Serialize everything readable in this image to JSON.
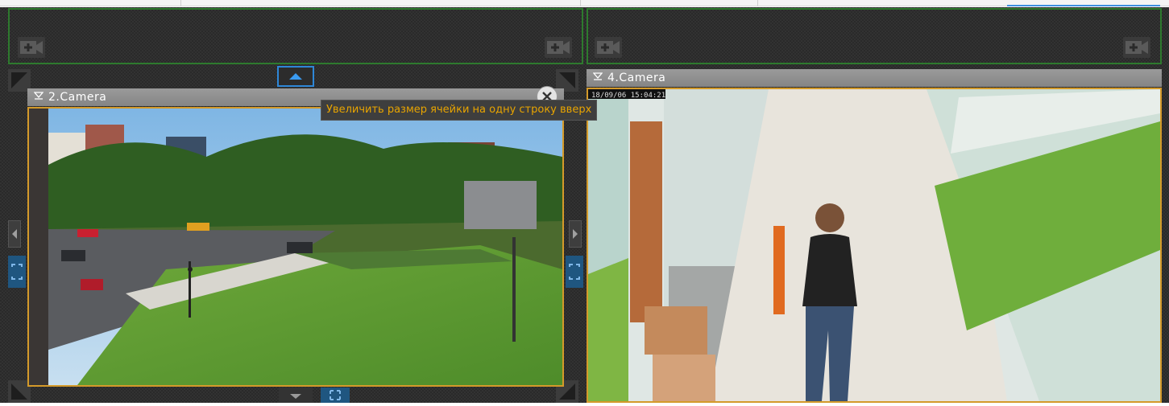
{
  "cameras": {
    "camera2": {
      "title": "2.Camera"
    },
    "camera4": {
      "title": "4.Camera",
      "timestamp": "18/09/06 15:04:21"
    }
  },
  "tooltip": {
    "text": "Увеличить размер ячейки на одну строку вверх"
  },
  "colors": {
    "selected_border": "#d49a2a",
    "empty_cell_border": "#2e7a2e",
    "tooltip_text": "#e8a400",
    "active_control": "#2e87d8"
  },
  "icons": {
    "add_camera": "add-camera-icon",
    "filter": "filter-icon",
    "close": "close-icon",
    "arrow_up": "arrow-up-icon",
    "arrow_left": "arrow-left-icon",
    "arrow_right": "arrow-right-icon",
    "expand": "expand-icon",
    "resize_corner": "resize-corner-icon"
  }
}
